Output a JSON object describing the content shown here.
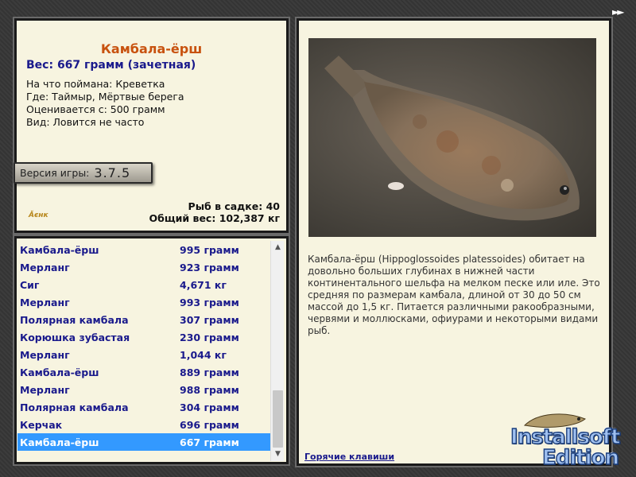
{
  "fish": {
    "title": "Камбала-ёрш",
    "weight": "Вес: 667 грамм (зачетная)",
    "bait": "На что поймана: Креветка",
    "place": "Где: Таймыр, Мёртвые берега",
    "threshold": "Оценивается с: 500 грамм",
    "frequency": "Вид: Ловится не часто"
  },
  "version": {
    "label": "Версия игры:",
    "value": "3.7.5"
  },
  "author_logo": "Ӑєнк",
  "stats": {
    "count": "Рыб в садке: 40",
    "total": "Общий вес: 102,387 кг"
  },
  "catch_list": [
    {
      "name": "Камбала-ёрш",
      "weight": "995 грамм"
    },
    {
      "name": "Мерланг",
      "weight": "923 грамм"
    },
    {
      "name": "Сиг",
      "weight": "4,671 кг"
    },
    {
      "name": "Мерланг",
      "weight": "993 грамм"
    },
    {
      "name": "Полярная камбала",
      "weight": "307 грамм"
    },
    {
      "name": "Корюшка зубастая",
      "weight": "230 грамм"
    },
    {
      "name": "Мерланг",
      "weight": "1,044 кг"
    },
    {
      "name": "Камбала-ёрш",
      "weight": "889 грамм"
    },
    {
      "name": "Мерланг",
      "weight": "988 грамм"
    },
    {
      "name": "Полярная камбала",
      "weight": "304 грамм"
    },
    {
      "name": "Керчак",
      "weight": "696 грамм"
    },
    {
      "name": "Камбала-ёрш",
      "weight": "667 грамм",
      "selected": true
    }
  ],
  "description": "Камбала-ёрш (Hippoglossoides platessoides) обитает на довольно больших глубинах в нижней части континентального шельфа на мелком песке или иле. Это средняя по размерам камбала, длиной от 30 до 50 см массой до 1,5 кг. Питается различными ракообразными, червями и моллюсками, офиурами и некоторыми видами рыб.",
  "hotkeys_link": "Горячие клавиши",
  "nav_arrow_icon": "double-chevron-right-icon",
  "edition_logo": {
    "line1": "Installsoft",
    "line2": "Edition"
  },
  "colors": {
    "title": "#c8520f",
    "accent_text": "#1a1a8c",
    "selected_row": "#3399ff",
    "panel_bg": "#f7f4e0"
  }
}
